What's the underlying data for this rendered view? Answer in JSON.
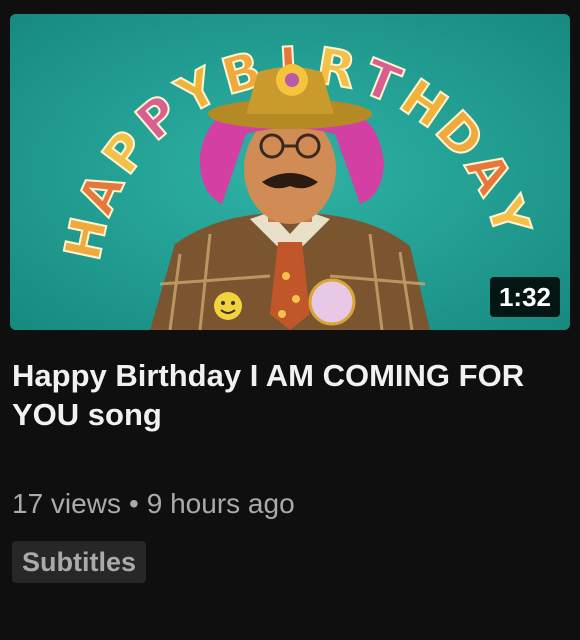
{
  "video": {
    "duration": "1:32",
    "title": "Happy Birthday I AM COMING FOR YOU song",
    "views": "17 views",
    "separator": "•",
    "age": "9 hours ago",
    "badge": "Subtitles"
  },
  "thumbnail": {
    "banner_letters": [
      "H",
      "A",
      "P",
      "P",
      "Y",
      "B",
      "I",
      "R",
      "T",
      "H",
      "D",
      "A",
      "Y"
    ]
  },
  "colors": {
    "background": "#0f0f0f",
    "title_text": "#f1f1f1",
    "meta_text": "#aaaaaa",
    "badge_bg": "#272727",
    "thumb_bg": "#1e9e92"
  }
}
